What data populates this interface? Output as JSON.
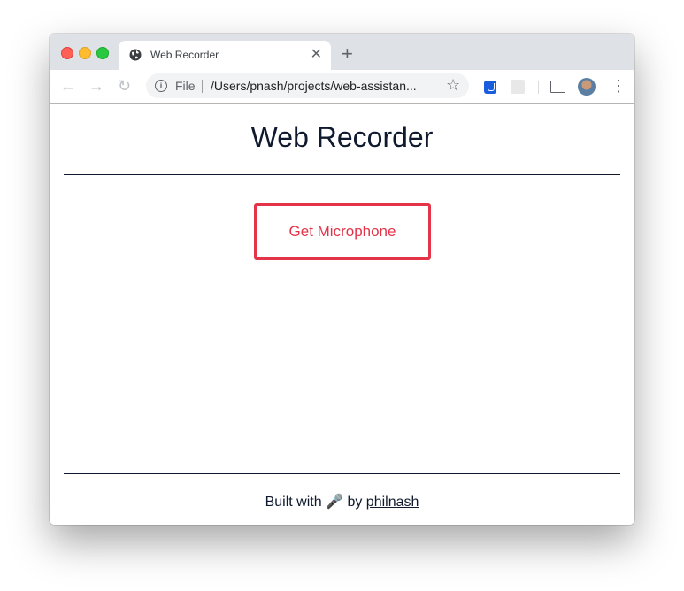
{
  "browser": {
    "tab": {
      "title": "Web Recorder",
      "favicon": "globe-icon",
      "close_glyph": "✕"
    },
    "new_tab_glyph": "+",
    "nav": {
      "back_glyph": "←",
      "forward_glyph": "→",
      "reload_glyph": "↻"
    },
    "omnibox": {
      "scheme_label": "File",
      "url": "/Users/pnash/projects/web-assistan...",
      "info_glyph": "i",
      "star_glyph": "☆"
    },
    "extensions": [
      "bitwarden-icon",
      "react-devtools-icon"
    ],
    "menu_glyph": "⋮"
  },
  "page": {
    "title": "Web Recorder",
    "button_label": "Get Microphone",
    "footer": {
      "prefix": "Built with",
      "emoji": "🎤",
      "middle": "by",
      "link_text": "philnash"
    }
  },
  "colors": {
    "accent": "#e3344a",
    "text": "#0f1a2e"
  }
}
